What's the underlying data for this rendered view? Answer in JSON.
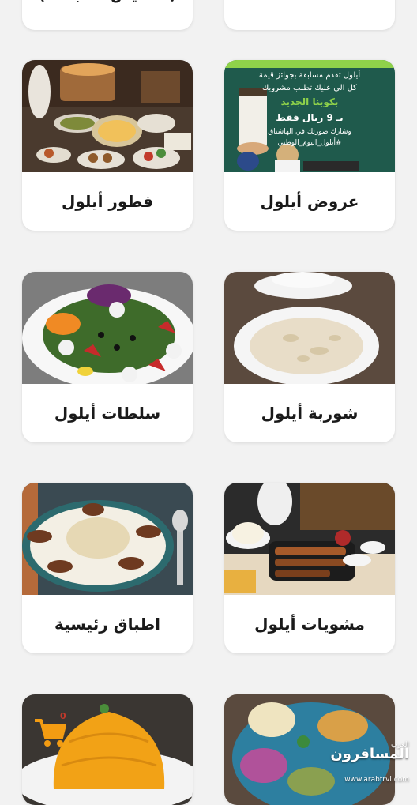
{
  "top_row": {
    "left_label": "(الخميس ، الجمعة)",
    "right_label": ""
  },
  "menu": [
    {
      "id": "breakfast",
      "label": "فطور أيلول"
    },
    {
      "id": "offers",
      "label": "عروض أيلول"
    },
    {
      "id": "salads",
      "label": "سلطات أيلول"
    },
    {
      "id": "soup",
      "label": "شوربة أيلول"
    },
    {
      "id": "main",
      "label": "اطباق رئيسية"
    },
    {
      "id": "grills",
      "label": "مشويات أيلول"
    }
  ],
  "promo": {
    "line1": "أيلول تقدم مسابقة بجوائز قيمة",
    "line2": "كل الي عليك تطلب مشروبك",
    "line3": "بكوبنا الجديد",
    "price": "بـ 9 ريال فقط",
    "line4": "وشارك صورتك في الهاشتاق",
    "hashtag": "#أيلول_اليوم_الوطني"
  },
  "cart": {
    "count": "0",
    "icon": "cart-icon",
    "color": "#f39c12"
  },
  "watermark": {
    "small": "العرب",
    "main": "المسافرون",
    "url": "www.arabtrvl.com"
  }
}
